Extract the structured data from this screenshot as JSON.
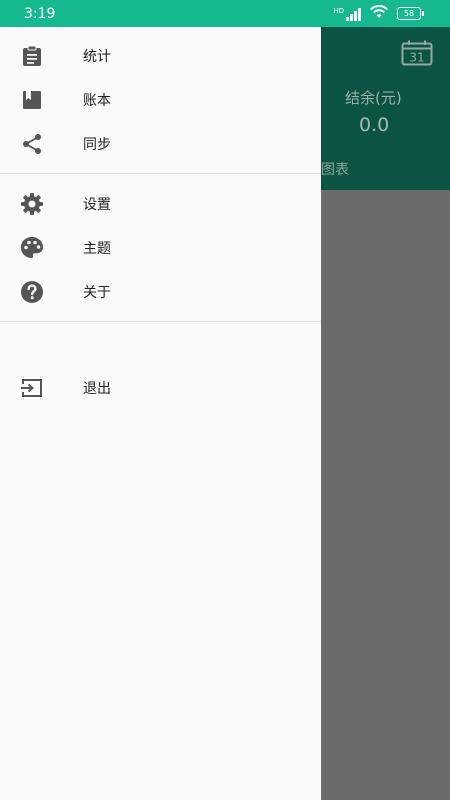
{
  "status_bar": {
    "time": "3:19",
    "network": "HD",
    "battery": "58"
  },
  "background_app": {
    "balance_label": "结余(元)",
    "balance_value": "0.0",
    "calendar_day": "31",
    "chart_tab_label": "图表"
  },
  "drawer": {
    "group1": [
      {
        "label": "统计",
        "icon": "clipboard-icon"
      },
      {
        "label": "账本",
        "icon": "book-icon"
      },
      {
        "label": "同步",
        "icon": "share-icon"
      }
    ],
    "group2": [
      {
        "label": "设置",
        "icon": "gear-icon"
      },
      {
        "label": "主题",
        "icon": "palette-icon"
      },
      {
        "label": "关于",
        "icon": "help-icon"
      }
    ],
    "group3": [
      {
        "label": "退出",
        "icon": "exit-icon"
      }
    ]
  },
  "colors": {
    "status_bar": "#16b98f",
    "header_dimmed": "#0b5342",
    "scrim": "#6b6b6b",
    "drawer_bg": "#fafafa",
    "icon": "#555555"
  }
}
